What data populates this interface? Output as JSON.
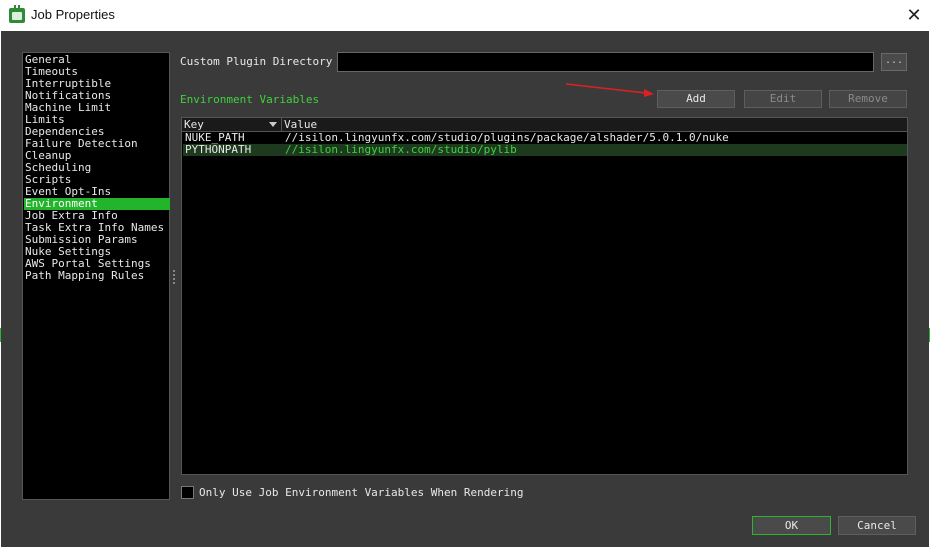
{
  "window": {
    "title": "Job Properties",
    "close_glyph": "✕"
  },
  "sidebar": {
    "items": [
      "General",
      "Timeouts",
      "Interruptible",
      "Notifications",
      "Machine Limit",
      "Limits",
      "Dependencies",
      "Failure Detection",
      "Cleanup",
      "Scheduling",
      "Scripts",
      "Event Opt-Ins",
      "Environment",
      "Job Extra Info",
      "Task Extra Info Names",
      "Submission Params",
      "Nuke Settings",
      "AWS Portal Settings",
      "Path Mapping Rules"
    ],
    "selected": "Environment"
  },
  "plugin": {
    "label": "Custom Plugin Directory",
    "value": "",
    "browse_label": "..."
  },
  "env": {
    "label": "Environment Variables",
    "add_label": "Add",
    "edit_label": "Edit",
    "remove_label": "Remove",
    "columns": {
      "key": "Key",
      "value": "Value"
    },
    "rows": [
      {
        "key": "NUKE_PATH",
        "value": "//isilon.lingyunfx.com/studio/plugins/package/alshader/5.0.1.0/nuke"
      },
      {
        "key": "PYTHONPATH",
        "value": "//isilon.lingyunfx.com/studio/pylib"
      }
    ]
  },
  "checkbox": {
    "label": "Only Use Job Environment Variables When Rendering",
    "checked": false
  },
  "footer": {
    "ok_label": "OK",
    "cancel_label": "Cancel"
  },
  "colors": {
    "accent": "#22b42a",
    "panel": "#3a3a3a",
    "annotation_arrow": "#e02020"
  }
}
